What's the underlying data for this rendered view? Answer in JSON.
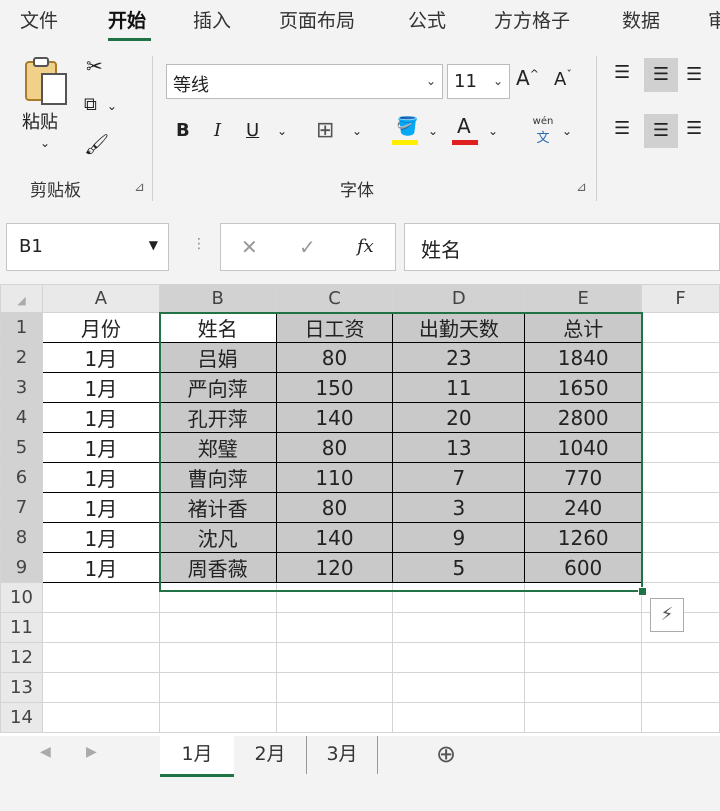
{
  "ribbon_tabs": [
    "文件",
    "开始",
    "插入",
    "页面布局",
    "公式",
    "方方格子",
    "数据",
    "审"
  ],
  "ribbon": {
    "paste_label": "粘贴",
    "clipboard_label": "剪贴板",
    "font_group_label": "字体",
    "font_name": "等线",
    "font_size": "11",
    "bold": "B",
    "italic": "I",
    "underline": "U",
    "increase_font": "A",
    "decrease_font": "A",
    "font_color": "A",
    "fill_color_accent": "#ffee00",
    "font_color_accent": "#e02020",
    "phonetic_top": "wén",
    "phonetic_bottom": "文"
  },
  "formula_bar": {
    "name_box": "B1",
    "fx": "fx",
    "cancel": "✕",
    "confirm": "✓",
    "content": "姓名"
  },
  "grid": {
    "columns": [
      "A",
      "B",
      "C",
      "D",
      "E",
      "F"
    ],
    "rows": [
      {
        "num": "1",
        "a": "月份",
        "b": "姓名",
        "c": "日工资",
        "d": "出勤天数",
        "e": "总计"
      },
      {
        "num": "2",
        "a": "1月",
        "b": "吕娟",
        "c": "80",
        "d": "23",
        "e": "1840"
      },
      {
        "num": "3",
        "a": "1月",
        "b": "严向萍",
        "c": "150",
        "d": "11",
        "e": "1650"
      },
      {
        "num": "4",
        "a": "1月",
        "b": "孔开萍",
        "c": "140",
        "d": "20",
        "e": "2800"
      },
      {
        "num": "5",
        "a": "1月",
        "b": "郑璧",
        "c": "80",
        "d": "13",
        "e": "1040"
      },
      {
        "num": "6",
        "a": "1月",
        "b": "曹向萍",
        "c": "110",
        "d": "7",
        "e": "770"
      },
      {
        "num": "7",
        "a": "1月",
        "b": "褚计香",
        "c": "80",
        "d": "3",
        "e": "240"
      },
      {
        "num": "8",
        "a": "1月",
        "b": "沈凡",
        "c": "140",
        "d": "9",
        "e": "1260"
      },
      {
        "num": "9",
        "a": "1月",
        "b": "周香薇",
        "c": "120",
        "d": "5",
        "e": "600"
      }
    ],
    "empty_rows": [
      "10",
      "11",
      "12",
      "13",
      "14"
    ]
  },
  "sheet_tabs": [
    "1月",
    "2月",
    "3月"
  ],
  "add_sheet": "⊕",
  "colors": {
    "accent": "#217346",
    "selection_fill": "#c9c9c9"
  }
}
